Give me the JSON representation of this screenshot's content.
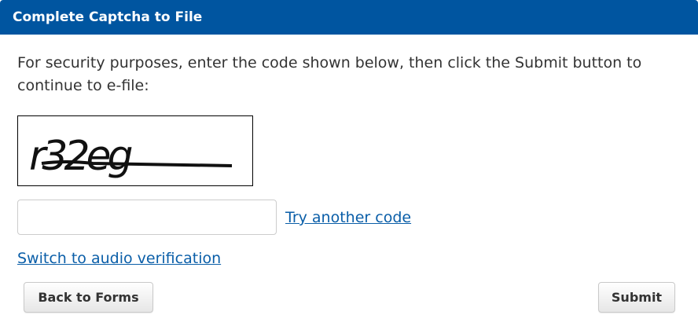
{
  "header": {
    "title": "Complete Captcha to File"
  },
  "instructions": {
    "text": "For security purposes, enter the code shown below, then click the Submit button to continue to e-file:"
  },
  "captcha": {
    "code_image_text": "r32eg"
  },
  "code_input": {
    "value": "",
    "placeholder": ""
  },
  "links": {
    "try_another": "Try another code",
    "audio": "Switch to audio verification"
  },
  "buttons": {
    "back": "Back to Forms",
    "submit": "Submit"
  },
  "colors": {
    "header_bg": "#0055a0",
    "link": "#0a5ea8"
  }
}
